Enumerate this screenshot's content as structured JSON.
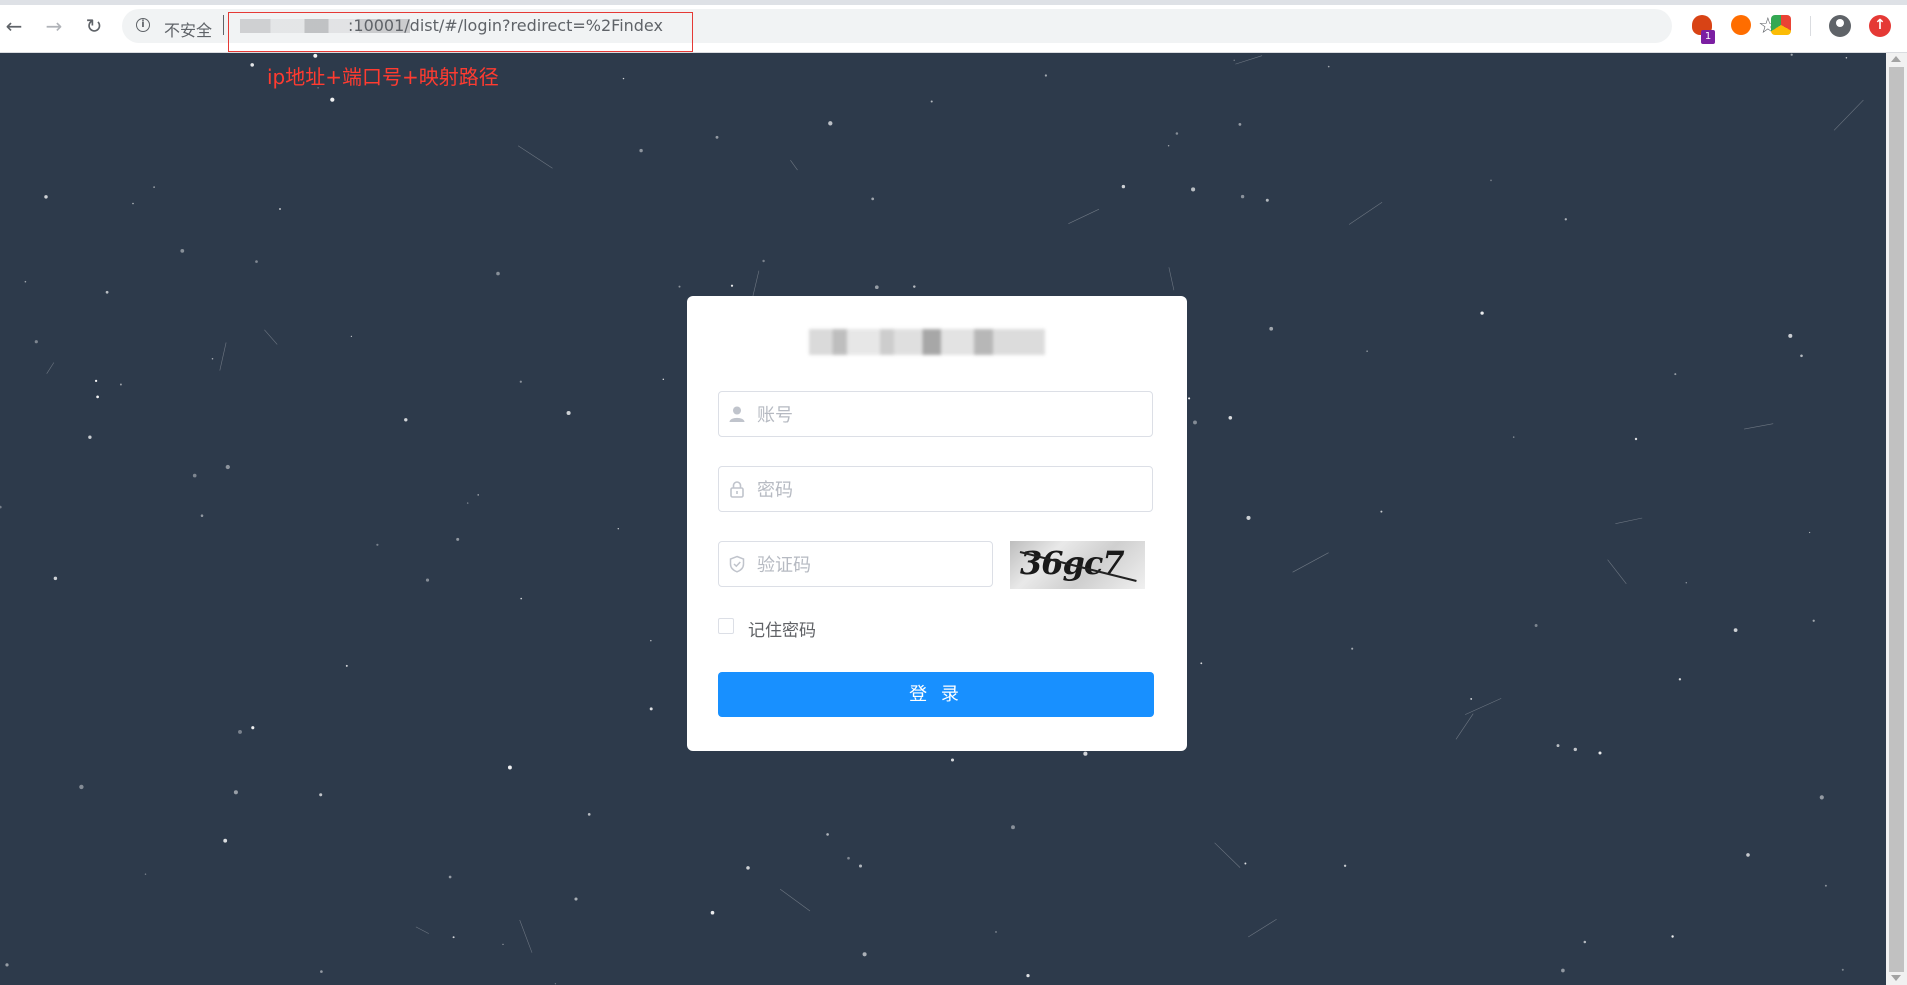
{
  "browser": {
    "insecure_label": "不安全",
    "url": ":10001/dist/#/login?redirect=%2Findex",
    "ext_badge_count": "1"
  },
  "annotation": {
    "text": "ip地址+端口号+映射路径",
    "color": "#ff3b30"
  },
  "login": {
    "title": "",
    "username_placeholder": "账号",
    "username_value": "",
    "password_placeholder": "密码",
    "password_value": "",
    "captcha_placeholder": "验证码",
    "captcha_value": "",
    "captcha_image_text": "36gc7",
    "remember_label": "记住密码",
    "remember_checked": false,
    "submit_label": "登 录"
  },
  "colors": {
    "background": "#2d3a4b",
    "primary_button": "#1890ff",
    "annotation_border": "#e53935"
  },
  "icons": {
    "back": "arrow-left-icon",
    "forward": "arrow-right-icon",
    "reload": "reload-icon",
    "info": "info-icon",
    "bookmark": "star-icon",
    "account": "account-icon",
    "update": "update-icon",
    "username": "user-icon",
    "password": "lock-icon",
    "captcha": "shield-icon"
  }
}
